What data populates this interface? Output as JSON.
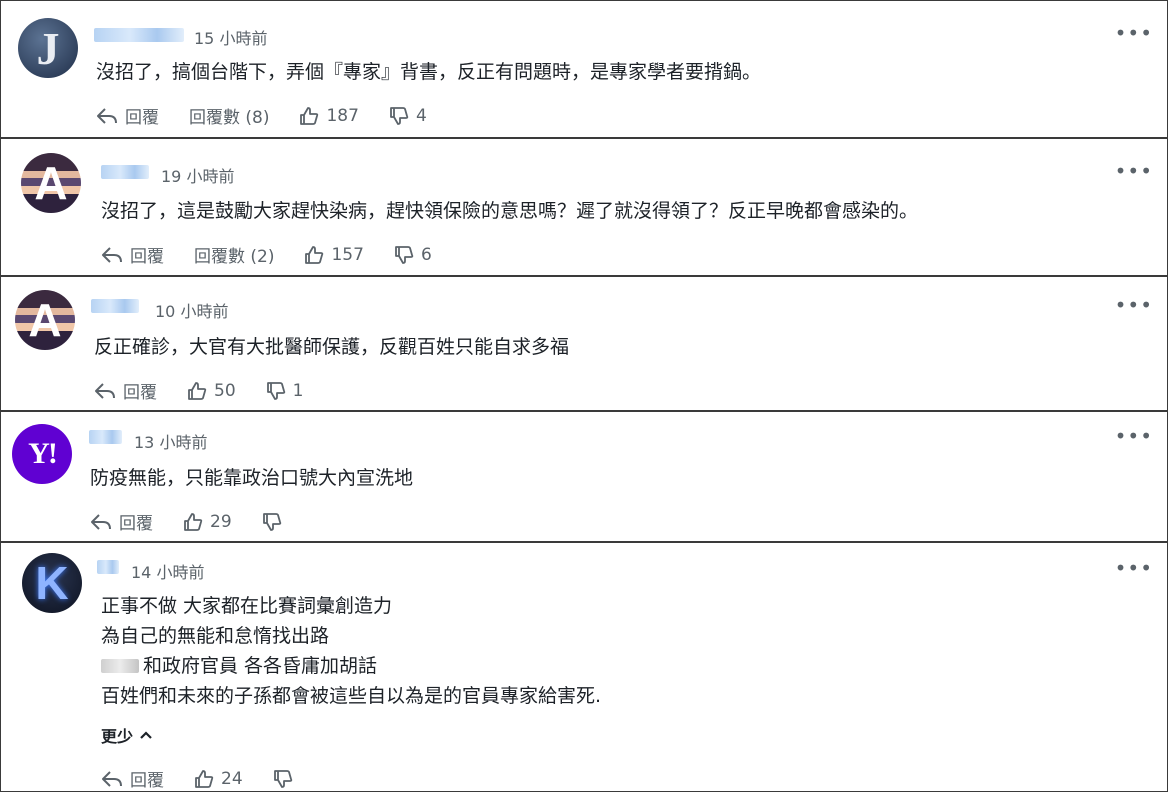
{
  "comments": [
    {
      "avatar_letter": "J",
      "time": "15 小時前",
      "lines": [
        "沒招了，搞個台階下，弄個『專家』背書，反正有問題時，是專家學者要揹鍋。"
      ],
      "reply_label": "回覆",
      "reply_count_label": "回覆數 (8)",
      "likes": "187",
      "dislikes": "4"
    },
    {
      "avatar_letter": "A",
      "time": "19 小時前",
      "lines": [
        "沒招了，這是鼓勵大家趕快染病，趕快領保險的意思嗎？遲了就沒得領了？反正早晚都會感染的。"
      ],
      "reply_label": "回覆",
      "reply_count_label": "回覆數 (2)",
      "likes": "157",
      "dislikes": "6"
    },
    {
      "avatar_letter": "A",
      "time": "10 小時前",
      "lines": [
        "反正確診，大官有大批醫師保護，反觀百姓只能自求多福"
      ],
      "reply_label": "回覆",
      "likes": "50",
      "dislikes": "1"
    },
    {
      "avatar_letter": "Y!",
      "time": "13 小時前",
      "lines": [
        "防疫無能，只能靠政治口號大內宣洗地"
      ],
      "reply_label": "回覆",
      "likes": "29",
      "dislikes": ""
    },
    {
      "avatar_letter": "K",
      "time": "14 小時前",
      "lines": [
        "正事不做 大家都在比賽詞彙創造力",
        "為自己的無能和怠惰找出路",
        "和政府官員 各各昏庸加胡話",
        "百姓們和未來的子孫都會被這些自以為是的官員專家給害死."
      ],
      "less_label": "更少",
      "reply_label": "回覆",
      "likes": "24",
      "dislikes": ""
    }
  ],
  "more_icon": "•••"
}
